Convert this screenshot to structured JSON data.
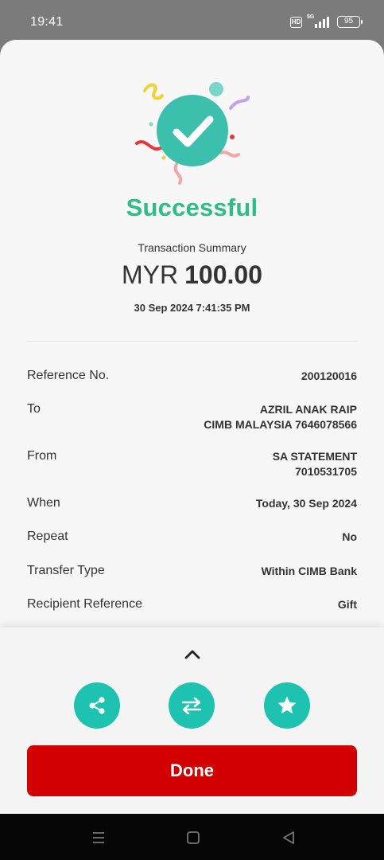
{
  "status_bar": {
    "time": "19:41",
    "hd_label": "HD",
    "network_label": "5G",
    "battery": "95"
  },
  "result": {
    "title": "Successful",
    "summary_label": "Transaction Summary",
    "currency": "MYR",
    "amount": "100.00",
    "datetime": "30 Sep 2024 7:41:35 PM"
  },
  "details": [
    {
      "label": "Reference No.",
      "value": "200120016"
    },
    {
      "label": "To",
      "value": "AZRIL ANAK RAIP",
      "value2": "CIMB MALAYSIA 7646078566"
    },
    {
      "label": "From",
      "value": "SA STATEMENT",
      "value2": "7010531705"
    },
    {
      "label": "When",
      "value": "Today, 30 Sep 2024"
    },
    {
      "label": "Repeat",
      "value": "No"
    },
    {
      "label": "Transfer Type",
      "value": "Within CIMB Bank"
    },
    {
      "label": "Recipient Reference",
      "value": "Gift"
    }
  ],
  "actions": {
    "icons": [
      "share-icon",
      "transfer-icon",
      "star-icon"
    ],
    "done_label": "Done"
  },
  "colors": {
    "success": "#2ebd85",
    "accent_teal": "#1ec2b0",
    "primary_red": "#d20000"
  }
}
